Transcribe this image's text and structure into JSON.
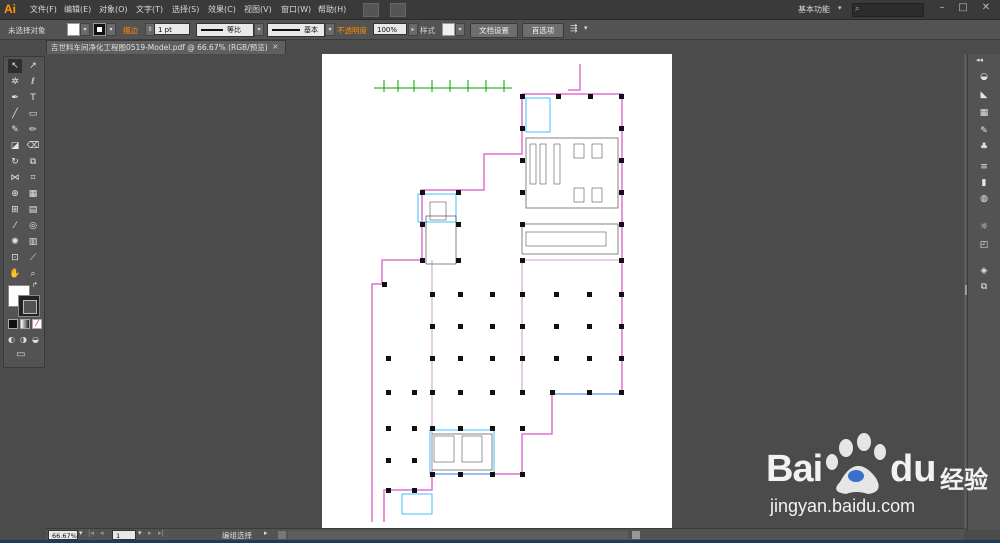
{
  "app": {
    "logo": "Ai"
  },
  "menu": [
    "文件(F)",
    "编辑(E)",
    "对象(O)",
    "文字(T)",
    "选择(S)",
    "效果(C)",
    "视图(V)",
    "窗口(W)",
    "帮助(H)"
  ],
  "workspace": "基本功能",
  "control": {
    "selection_label": "未选择对象",
    "stroke_label": "描边",
    "stroke_weight": "1 pt",
    "profile_label": "等比",
    "brush_label": "基本",
    "opacity_label": "不透明度",
    "opacity_value": "100%",
    "style_label": "样式",
    "doc_setup_button": "文档设置",
    "preferences_button": "首选项"
  },
  "document": {
    "tab_title": "吉世料车间净化工程图0519-Model.pdf @ 66.67% (RGB/预览)"
  },
  "status": {
    "zoom": "66.67%",
    "page": "1",
    "mode": "编组选择"
  },
  "watermark": {
    "brand": "Bai",
    "brand2": "du",
    "suffix": "经验",
    "url": "jingyan.baidu.com"
  },
  "colors": {
    "accent": "#ff9a00",
    "baidu_blue": "#2f68c9"
  }
}
